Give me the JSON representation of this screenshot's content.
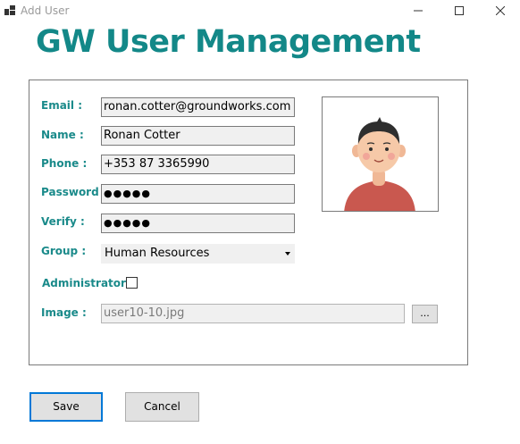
{
  "window": {
    "title": "Add User",
    "icons": {
      "app": "app-icon",
      "minimize": "minimize-icon",
      "maximize": "maximize-icon",
      "close": "close-icon"
    }
  },
  "heading": "GW User Management",
  "form": {
    "email": {
      "label": "Email :",
      "value": "ronan.cotter@groundworks.com"
    },
    "name": {
      "label": "Name :",
      "value": "Ronan Cotter"
    },
    "phone": {
      "label": "Phone :",
      "value": "+353 87 3365990"
    },
    "password": {
      "label": "Password :",
      "value": "●●●●●"
    },
    "verify": {
      "label": "Verify :",
      "value": "●●●●●"
    },
    "group": {
      "label": "Group :",
      "selected": "Human Resources"
    },
    "administrator": {
      "label": "Administrator :",
      "checked": false
    },
    "image": {
      "label": "Image :",
      "value": "user10-10.jpg",
      "browse_label": "..."
    }
  },
  "buttons": {
    "save": "Save",
    "cancel": "Cancel"
  },
  "colors": {
    "accent": "#138888",
    "label": "#1a8a8a",
    "focus_border": "#0078d7"
  }
}
